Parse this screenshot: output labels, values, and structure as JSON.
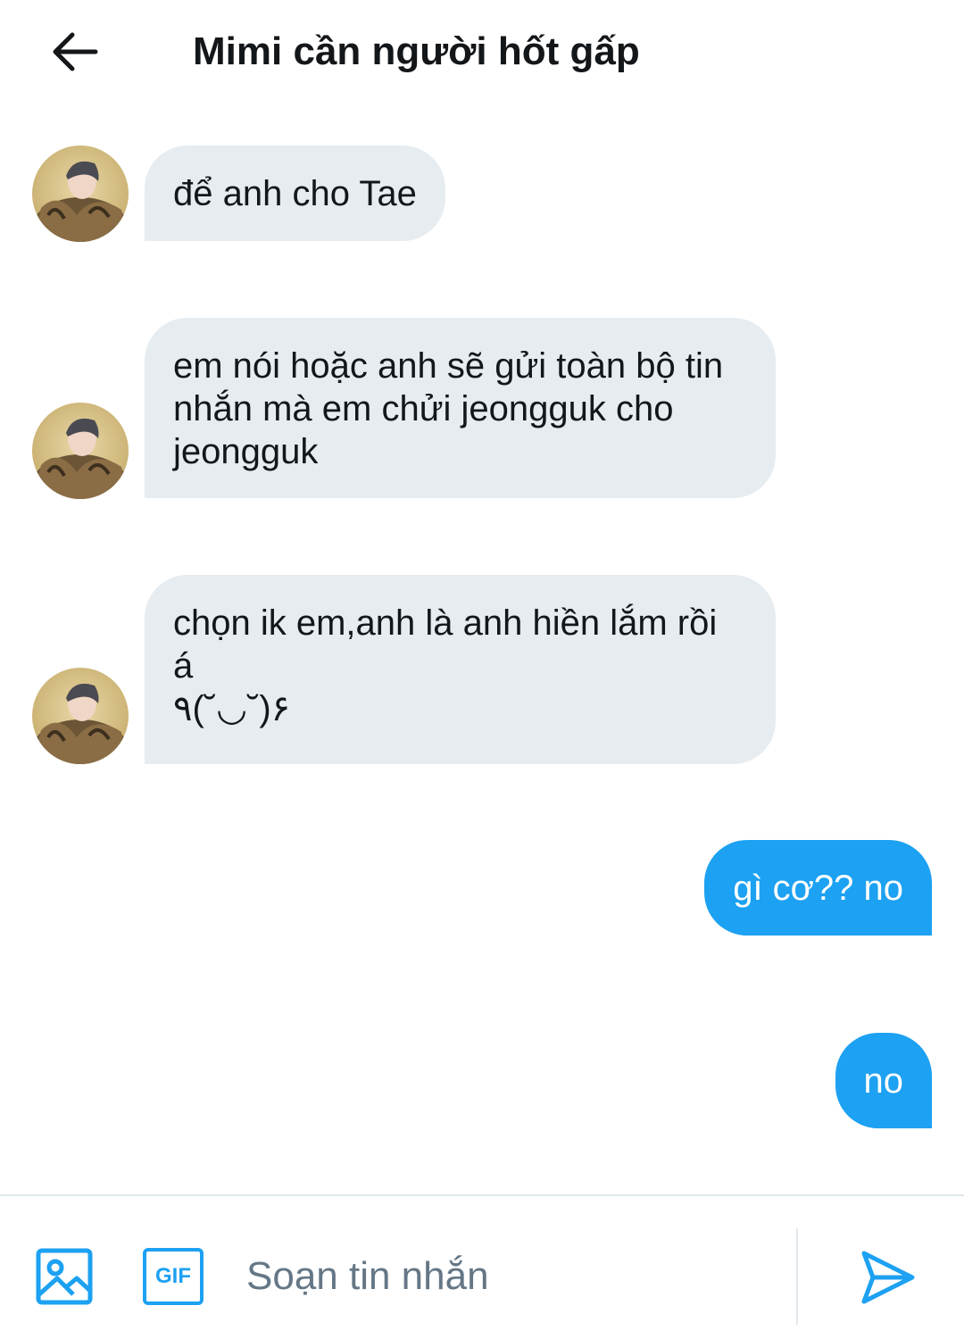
{
  "header": {
    "title": "Mimi cần người hốt gấp",
    "back_icon": "arrow-left-icon"
  },
  "messages": [
    {
      "direction": "incoming",
      "text": "để anh cho Tae"
    },
    {
      "direction": "incoming",
      "text": "em nói hoặc anh sẽ gửi toàn bộ tin\nnhắn mà em chửi jeongguk cho\njeongguk"
    },
    {
      "direction": "incoming",
      "text": "chọn ik em,anh là anh hiền lắm rồi\ná\n٩(˘◡˘)۶"
    },
    {
      "direction": "outgoing",
      "text": "gì cơ?? no"
    },
    {
      "direction": "outgoing",
      "text": "no"
    }
  ],
  "composer": {
    "placeholder": "Soạn tin nhắn",
    "value": "",
    "gif_label": "GIF",
    "image_icon": "image-icon",
    "send_icon": "send-icon"
  },
  "colors": {
    "accent": "#1da1f2",
    "incoming_bubble": "#e6ecf0",
    "text": "#14171a",
    "placeholder": "#657786",
    "divider": "#e1e8ed"
  }
}
